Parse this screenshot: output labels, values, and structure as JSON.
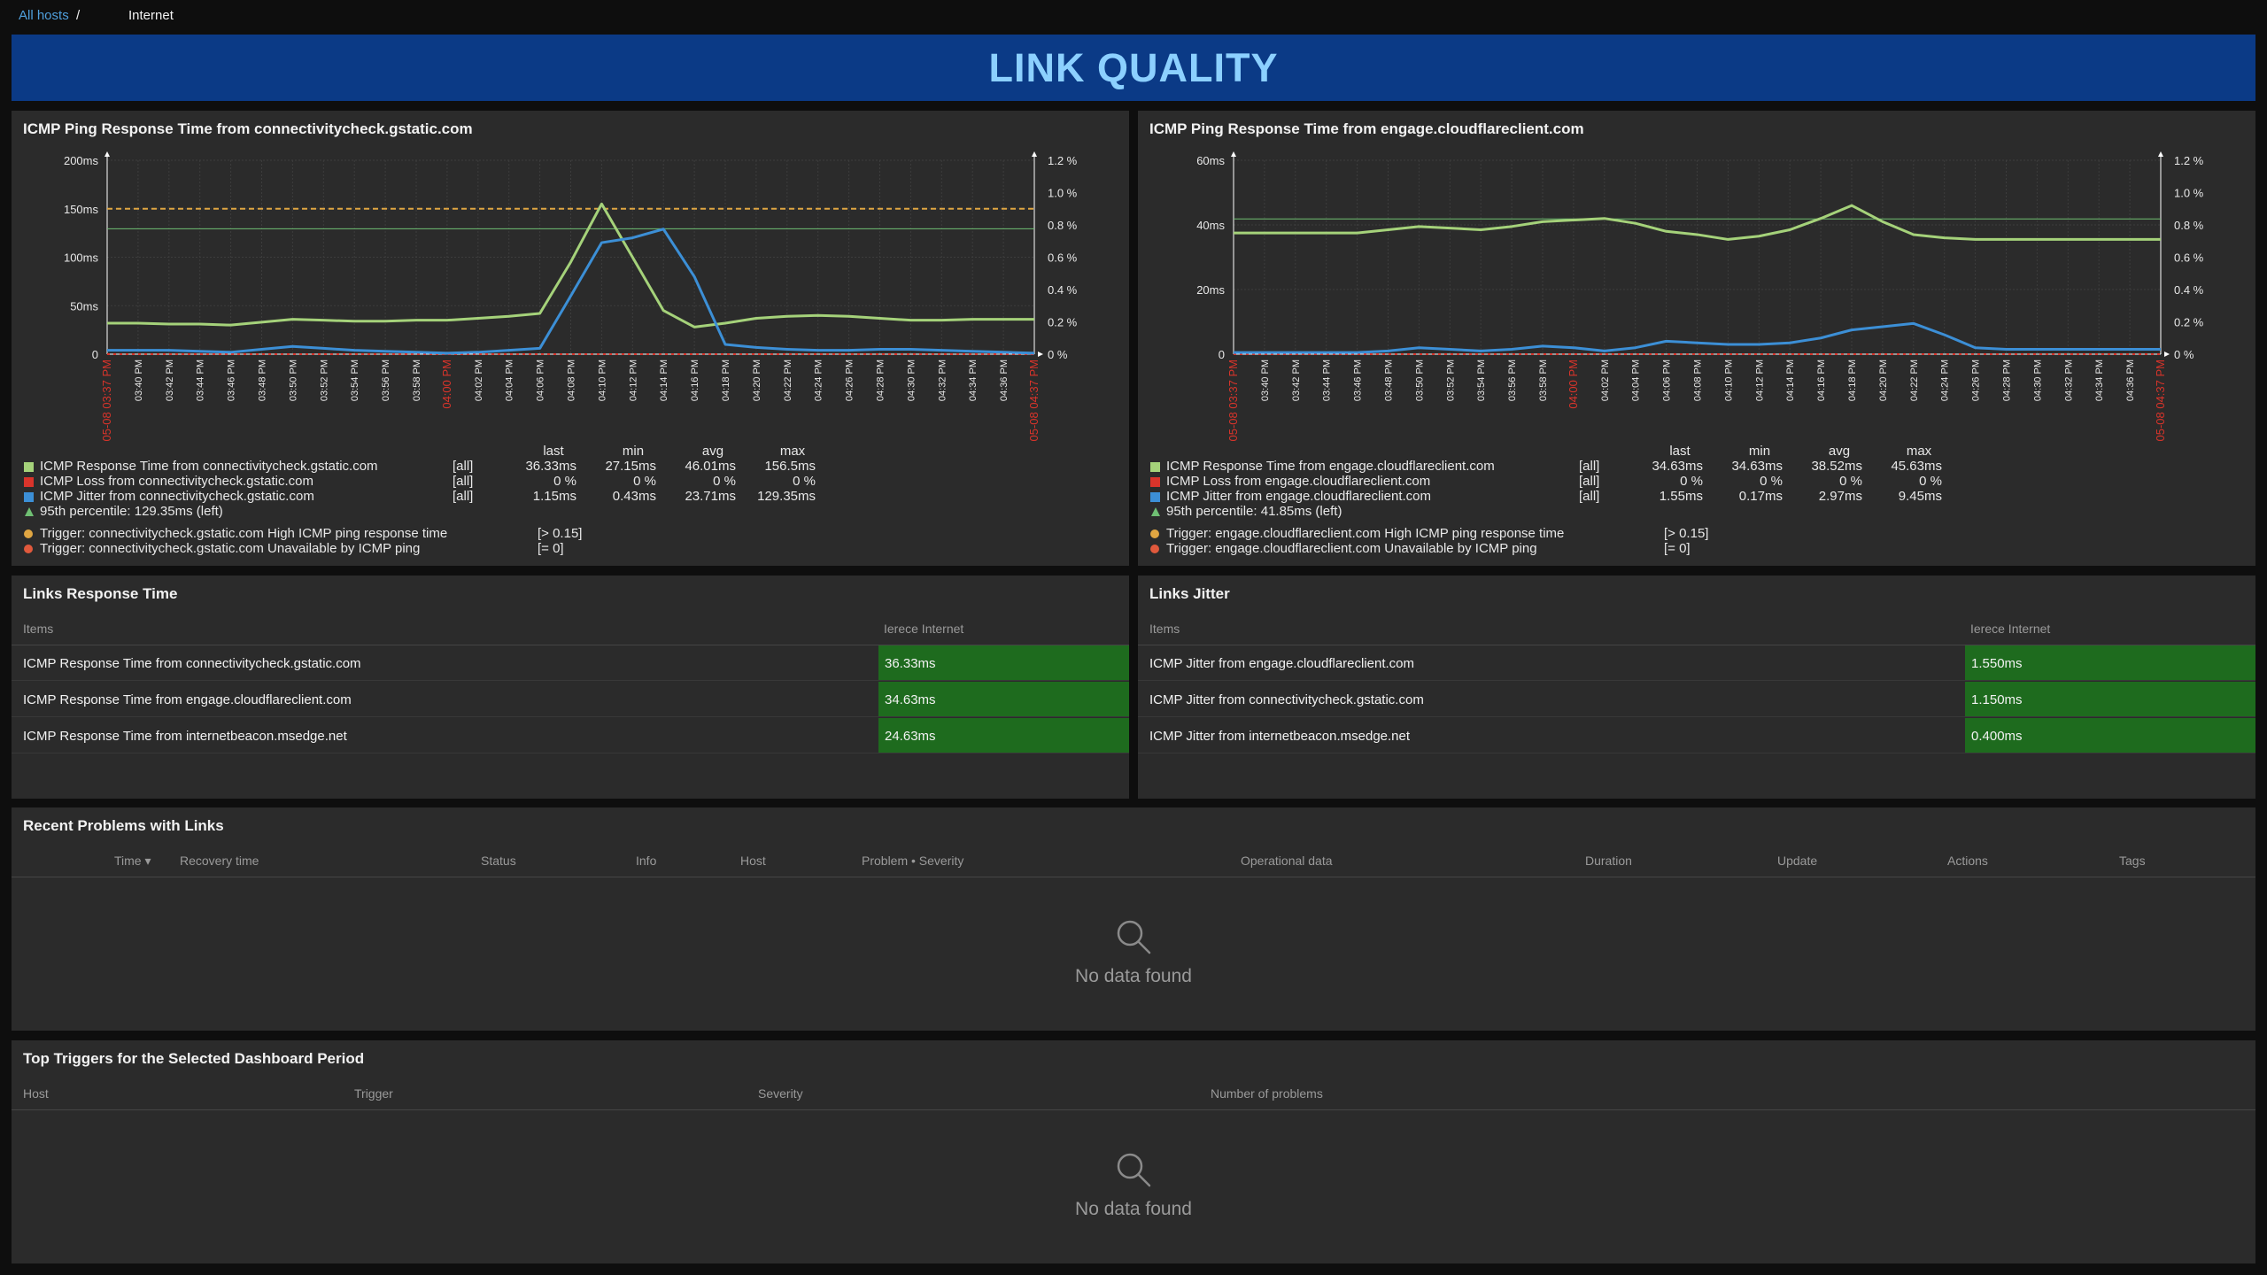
{
  "breadcrumb": {
    "all_hosts": "All hosts",
    "separator": "/",
    "current": "Internet"
  },
  "banner": {
    "title": "LINK QUALITY"
  },
  "colors": {
    "green": "#a5d27a",
    "blue": "#3c8fd6",
    "red": "#d9342b",
    "trigger": "#e0a642",
    "highlight": "#1e6b1e"
  },
  "time_labels": [
    "05-08 03:37 PM",
    "03:40 PM",
    "03:42 PM",
    "03:44 PM",
    "03:46 PM",
    "03:48 PM",
    "03:50 PM",
    "03:52 PM",
    "03:54 PM",
    "03:56 PM",
    "03:58 PM",
    "04:00 PM",
    "04:02 PM",
    "04:04 PM",
    "04:06 PM",
    "04:08 PM",
    "04:10 PM",
    "04:12 PM",
    "04:14 PM",
    "04:16 PM",
    "04:18 PM",
    "04:20 PM",
    "04:22 PM",
    "04:24 PM",
    "04:26 PM",
    "04:28 PM",
    "04:30 PM",
    "04:32 PM",
    "04:34 PM",
    "04:36 PM",
    "05-08 04:37 PM"
  ],
  "red_time_labels": [
    "05-08 03:37 PM",
    "04:00 PM",
    "05-08 04:37 PM"
  ],
  "chart_data": [
    {
      "type": "line",
      "title": "ICMP Ping Response Time from connectivitycheck.gstatic.com",
      "y_left_ticks": [
        "0",
        "50ms",
        "100ms",
        "150ms",
        "200ms"
      ],
      "y_right_ticks": [
        "0 %",
        "0.2 %",
        "0.4 %",
        "0.6 %",
        "0.8 %",
        "1.0 %",
        "1.2 %"
      ],
      "ylim": [
        0,
        200
      ],
      "y2lim": [
        0,
        1.2
      ],
      "x": [
        0,
        1,
        2,
        3,
        4,
        5,
        6,
        7,
        8,
        9,
        10,
        11,
        12,
        13,
        14,
        15,
        16,
        17,
        18,
        19,
        20,
        21,
        22,
        23,
        24,
        25,
        26,
        27,
        28,
        29,
        30
      ],
      "series": [
        {
          "name": "ICMP Response Time from connectivitycheck.gstatic.com",
          "color": "#a5d27a",
          "values": [
            32,
            32,
            31,
            31,
            30,
            33,
            36,
            35,
            34,
            34,
            35,
            35,
            37,
            39,
            42,
            95,
            155,
            100,
            45,
            28,
            32,
            37,
            39,
            40,
            39,
            37,
            35,
            35,
            36,
            36,
            36
          ]
        },
        {
          "name": "ICMP Loss from connectivitycheck.gstatic.com",
          "color": "#d9342b",
          "values": [
            0,
            0,
            0,
            0,
            0,
            0,
            0,
            0,
            0,
            0,
            0,
            0,
            0,
            0,
            0,
            0,
            0,
            0,
            0,
            0,
            0,
            0,
            0,
            0,
            0,
            0,
            0,
            0,
            0,
            0,
            0
          ]
        },
        {
          "name": "ICMP Jitter from connectivitycheck.gstatic.com",
          "color": "#3c8fd6",
          "values": [
            4,
            4,
            4,
            3,
            2,
            5,
            8,
            6,
            4,
            3,
            2,
            1,
            2,
            4,
            6,
            60,
            115,
            120,
            129,
            80,
            10,
            7,
            5,
            4,
            4,
            5,
            5,
            4,
            3,
            2,
            1
          ]
        }
      ],
      "percentile": 129.35,
      "trigger_threshold": 150,
      "legend": {
        "headers": [
          "last",
          "min",
          "avg",
          "max"
        ],
        "rows": [
          {
            "name": "ICMP Response Time from connectivitycheck.gstatic.com",
            "func": "[all]",
            "last": "36.33ms",
            "min": "27.15ms",
            "avg": "46.01ms",
            "max": "156.5ms"
          },
          {
            "name": "ICMP Loss from connectivitycheck.gstatic.com",
            "func": "[all]",
            "last": "0 %",
            "min": "0 %",
            "avg": "0 %",
            "max": "0 %"
          },
          {
            "name": "ICMP Jitter from connectivitycheck.gstatic.com",
            "func": "[all]",
            "last": "1.15ms",
            "min": "0.43ms",
            "avg": "23.71ms",
            "max": "129.35ms"
          }
        ],
        "percentile_text": "95th percentile: 129.35ms (left)",
        "triggers": [
          {
            "name": "Trigger: connectivitycheck.gstatic.com High ICMP ping response time",
            "cond": "[> 0.15]"
          },
          {
            "name": "Trigger: connectivitycheck.gstatic.com Unavailable by ICMP ping",
            "cond": "[= 0]"
          }
        ]
      }
    },
    {
      "type": "line",
      "title": "ICMP Ping Response Time from engage.cloudflareclient.com",
      "y_left_ticks": [
        "0",
        "20ms",
        "40ms",
        "60ms"
      ],
      "y_right_ticks": [
        "0 %",
        "0.2 %",
        "0.4 %",
        "0.6 %",
        "0.8 %",
        "1.0 %",
        "1.2 %"
      ],
      "ylim": [
        0,
        60
      ],
      "y2lim": [
        0,
        1.2
      ],
      "x": [
        0,
        1,
        2,
        3,
        4,
        5,
        6,
        7,
        8,
        9,
        10,
        11,
        12,
        13,
        14,
        15,
        16,
        17,
        18,
        19,
        20,
        21,
        22,
        23,
        24,
        25,
        26,
        27,
        28,
        29,
        30
      ],
      "series": [
        {
          "name": "ICMP Response Time from engage.cloudflareclient.com",
          "color": "#a5d27a",
          "values": [
            37.5,
            37.5,
            37.5,
            37.5,
            37.5,
            38.5,
            39.5,
            39,
            38.5,
            39.5,
            41,
            41.5,
            42,
            40.5,
            38,
            37,
            35.5,
            36.5,
            38.5,
            42,
            46,
            41,
            37,
            36,
            35.5,
            35.5,
            35.5,
            35.5,
            35.5,
            35.5,
            35.5
          ]
        },
        {
          "name": "ICMP Loss from engage.cloudflareclient.com",
          "color": "#d9342b",
          "values": [
            0,
            0,
            0,
            0,
            0,
            0,
            0,
            0,
            0,
            0,
            0,
            0,
            0,
            0,
            0,
            0,
            0,
            0,
            0,
            0,
            0,
            0,
            0,
            0,
            0,
            0,
            0,
            0,
            0,
            0,
            0
          ]
        },
        {
          "name": "ICMP Jitter from engage.cloudflareclient.com",
          "color": "#3c8fd6",
          "values": [
            0.5,
            0.5,
            0.5,
            0.5,
            0.5,
            1,
            2,
            1.5,
            1,
            1.5,
            2.5,
            2,
            1,
            2,
            4,
            3.5,
            3,
            3,
            3.5,
            5,
            7.5,
            8.5,
            9.5,
            6,
            2,
            1.5,
            1.5,
            1.5,
            1.5,
            1.5,
            1.5
          ]
        }
      ],
      "percentile": 41.85,
      "trigger_threshold": null,
      "legend": {
        "headers": [
          "last",
          "min",
          "avg",
          "max"
        ],
        "rows": [
          {
            "name": "ICMP Response Time from engage.cloudflareclient.com",
            "func": "[all]",
            "last": "34.63ms",
            "min": "34.63ms",
            "avg": "38.52ms",
            "max": "45.63ms"
          },
          {
            "name": "ICMP Loss from engage.cloudflareclient.com",
            "func": "[all]",
            "last": "0 %",
            "min": "0 %",
            "avg": "0 %",
            "max": "0 %"
          },
          {
            "name": "ICMP Jitter from engage.cloudflareclient.com",
            "func": "[all]",
            "last": "1.55ms",
            "min": "0.17ms",
            "avg": "2.97ms",
            "max": "9.45ms"
          }
        ],
        "percentile_text": "95th percentile: 41.85ms (left)",
        "triggers": [
          {
            "name": "Trigger: engage.cloudflareclient.com High ICMP ping response time",
            "cond": "[> 0.15]"
          },
          {
            "name": "Trigger: engage.cloudflareclient.com Unavailable by ICMP ping",
            "cond": "[= 0]"
          }
        ]
      }
    }
  ],
  "response_table": {
    "title": "Links Response Time",
    "col_items": "Items",
    "col_host": "Ierece Internet",
    "rows": [
      {
        "label": "ICMP Response Time from connectivitycheck.gstatic.com",
        "value": "36.33ms"
      },
      {
        "label": "ICMP Response Time from engage.cloudflareclient.com",
        "value": "34.63ms"
      },
      {
        "label": "ICMP Response Time from internetbeacon.msedge.net",
        "value": "24.63ms"
      }
    ]
  },
  "jitter_table": {
    "title": "Links Jitter",
    "col_items": "Items",
    "col_host": "Ierece Internet",
    "rows": [
      {
        "label": "ICMP Jitter from engage.cloudflareclient.com",
        "value": "1.550ms"
      },
      {
        "label": "ICMP Jitter from connectivitycheck.gstatic.com",
        "value": "1.150ms"
      },
      {
        "label": "ICMP Jitter from internetbeacon.msedge.net",
        "value": "0.400ms"
      }
    ]
  },
  "problems": {
    "title": "Recent Problems with Links",
    "columns": [
      "Time ▾",
      "Recovery time",
      "Status",
      "Info",
      "Host",
      "Problem • Severity",
      "Operational data",
      "Duration",
      "Update",
      "Actions",
      "Tags"
    ],
    "empty_text": "No data found"
  },
  "top_triggers": {
    "title": "Top Triggers for the Selected Dashboard Period",
    "columns": [
      "Host",
      "Trigger",
      "Severity",
      "Number of problems"
    ],
    "empty_text": "No data found"
  }
}
